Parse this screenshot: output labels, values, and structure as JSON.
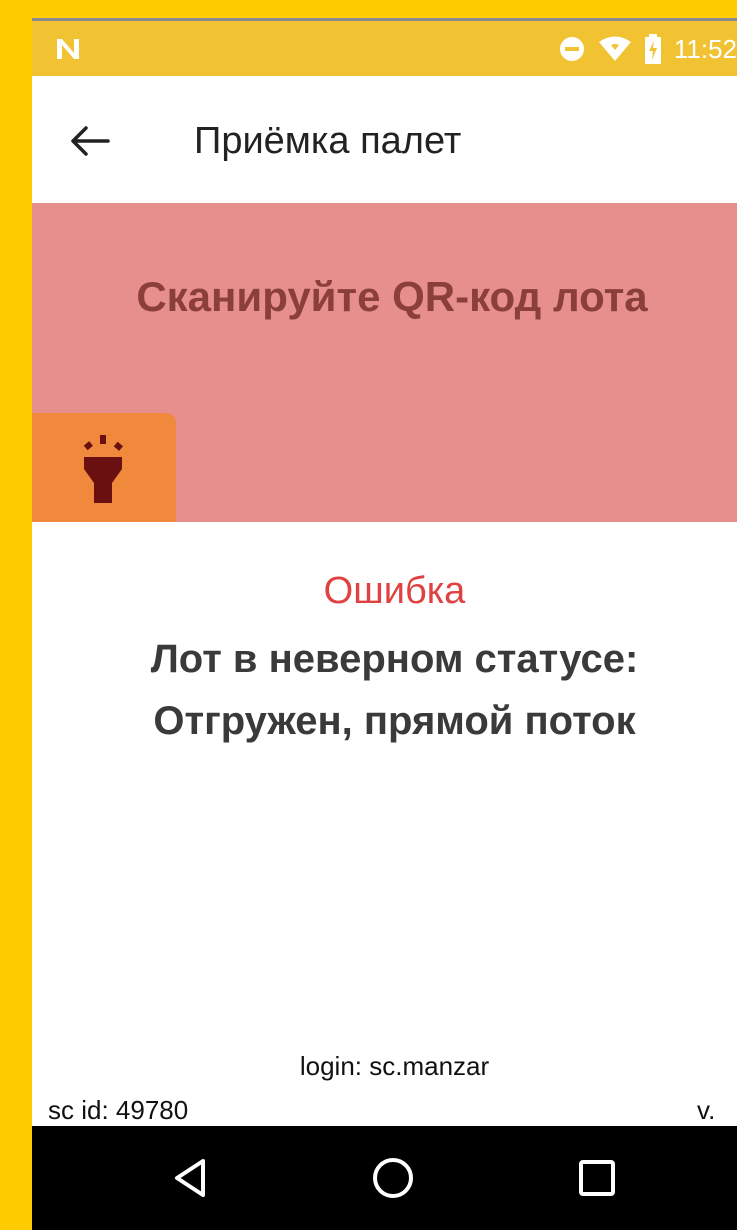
{
  "status_bar": {
    "time": "11:52",
    "icons": [
      "notification-n-icon",
      "do-not-disturb-icon",
      "wifi-icon",
      "battery-charging-icon"
    ]
  },
  "app_bar": {
    "back_icon": "arrow-left-icon",
    "title": "Приёмка палет"
  },
  "scan_panel": {
    "prompt": "Сканируйте QR-код лота",
    "flashlight_icon": "flashlight-icon",
    "background_color": "#E68F8C",
    "button_color": "#F0893B"
  },
  "error": {
    "title": "Ошибка",
    "message_line1": "Лот в неверном статусе:",
    "message_line2": "Отгружен, прямой поток",
    "title_color": "#E04141"
  },
  "footer": {
    "login": "login: sc.manzar",
    "sc_id": "sc id: 49780",
    "version": "v."
  },
  "nav_bar": {
    "icons": [
      "back-triangle-icon",
      "home-circle-icon",
      "recents-square-icon"
    ]
  },
  "colors": {
    "frame": "#FFCC00",
    "status_bar": "#F1C232"
  }
}
